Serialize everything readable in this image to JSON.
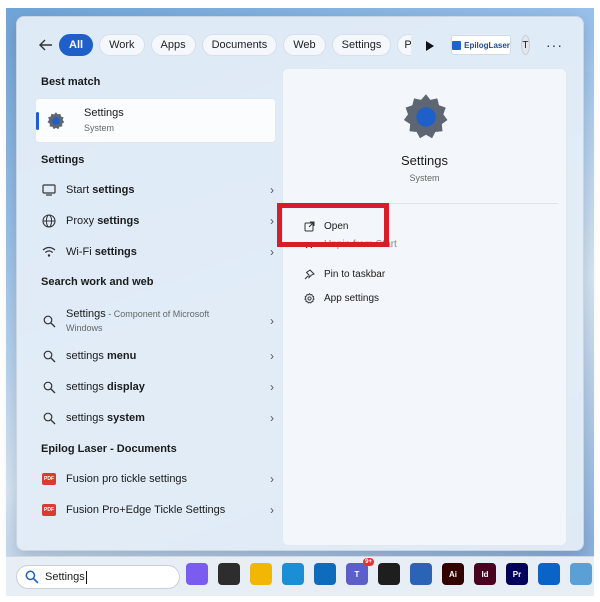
{
  "filters": {
    "items": [
      {
        "label": "All",
        "active": true
      },
      {
        "label": "Work"
      },
      {
        "label": "Apps"
      },
      {
        "label": "Documents"
      },
      {
        "label": "Web"
      },
      {
        "label": "Settings"
      },
      {
        "label": "Peop"
      }
    ],
    "brand_label": "EpilogLaser",
    "avatar_initial": "T",
    "more_label": "···"
  },
  "best_match": {
    "heading": "Best match",
    "title": "Settings",
    "subtitle": "System"
  },
  "settings_section": {
    "heading": "Settings",
    "items": [
      {
        "text": "Start ",
        "bold": "settings",
        "icon": "monitor-icon"
      },
      {
        "text": "Proxy ",
        "bold": "settings",
        "icon": "globe-icon"
      },
      {
        "text": "Wi-Fi ",
        "bold": "settings",
        "icon": "wifi-icon"
      }
    ]
  },
  "web_section": {
    "heading": "Search work and web",
    "first": {
      "title": "Settings",
      "detail": " - Component of Microsoft",
      "line2": "Windows"
    },
    "items": [
      {
        "text": "settings ",
        "bold": "menu"
      },
      {
        "text": "settings ",
        "bold": "display"
      },
      {
        "text": "settings ",
        "bold": "system"
      }
    ]
  },
  "docs_section": {
    "heading": "Epilog Laser - Documents",
    "items": [
      {
        "text": "Fusion pro tickle settings",
        "icon_label": "PDF"
      },
      {
        "text": "Fusion Pro+Edge Tickle Settings",
        "icon_label": "PDF"
      }
    ]
  },
  "detail": {
    "title": "Settings",
    "subtitle": "System",
    "actions": [
      {
        "label": "Open"
      },
      {
        "label": "Unpin from Start"
      },
      {
        "label": "Pin to taskbar"
      },
      {
        "label": "App settings"
      }
    ]
  },
  "taskbar": {
    "search_value": "Settings",
    "teams_badge": "9+",
    "icons": [
      {
        "name": "copilot-icon",
        "label": "",
        "color": "#7a5cf0"
      },
      {
        "name": "taskview-icon",
        "label": "",
        "color": "#2d2d2d"
      },
      {
        "name": "file-explorer-icon",
        "label": "",
        "color": "#f2b705"
      },
      {
        "name": "edge-icon",
        "label": "",
        "color": "#1a8fd6"
      },
      {
        "name": "outlook-icon",
        "label": "",
        "color": "#0f6cbd"
      },
      {
        "name": "teams-icon",
        "label": "T",
        "color": "#5b5fc7"
      },
      {
        "name": "terminal-icon",
        "label": "",
        "color": "#1e1e1e"
      },
      {
        "name": "app-icon",
        "label": "",
        "color": "#2b64b6"
      },
      {
        "name": "illustrator-icon",
        "label": "Ai",
        "color": "#330000"
      },
      {
        "name": "indesign-icon",
        "label": "Id",
        "color": "#49021f"
      },
      {
        "name": "premiere-icon",
        "label": "Pr",
        "color": "#00005b"
      },
      {
        "name": "outlook-new-icon",
        "label": "",
        "color": "#0a64c8"
      },
      {
        "name": "network-app-icon",
        "label": "",
        "color": "#5aa0d6"
      }
    ]
  },
  "colors": {
    "accent": "#1e5fc8",
    "highlight": "#d61e28"
  }
}
